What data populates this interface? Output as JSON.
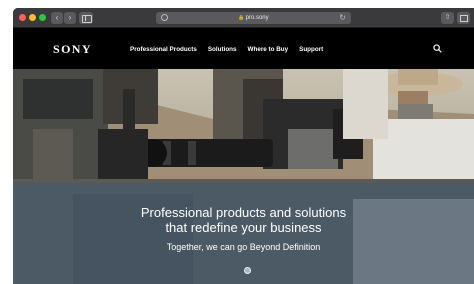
{
  "browser": {
    "url": "pro.sony",
    "nav_back_glyph": "‹",
    "nav_forward_glyph": "›"
  },
  "site": {
    "logo": "SONY",
    "nav": [
      {
        "label": "Professional Products"
      },
      {
        "label": "Solutions"
      },
      {
        "label": "Where to Buy"
      },
      {
        "label": "Support"
      }
    ]
  },
  "hero": {
    "headline_line1": "Professional products and solutions",
    "headline_line2": "that redefine your business",
    "subline": "Together, we can go Beyond Definition"
  },
  "colors": {
    "header_bg": "#000000",
    "overlay": "#465a6e",
    "titlebar": "#3a3a3c"
  },
  "icons": [
    "privacy-icon",
    "lock-icon",
    "reload-icon",
    "share-icon",
    "tabs-icon",
    "search-icon"
  ]
}
